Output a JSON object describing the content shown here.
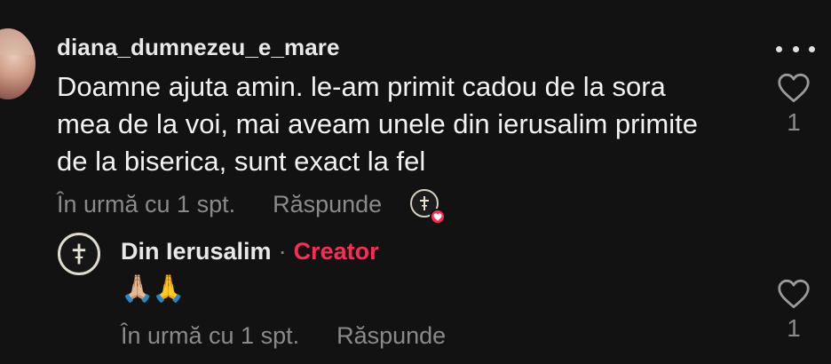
{
  "comment": {
    "username": "diana_dumnezeu_e_mare",
    "text": "Doamne ajuta amin. le-am primit cadou de la sora\nmea de la voi, mai aveam unele din ierusalim primite\nde la biserica, sunt exact la fel",
    "time": "În urmă cu 1 spt.",
    "reply_label": "Răspunde",
    "like_count": "1",
    "liked_by_creator": true
  },
  "reply": {
    "author": "Din Ierusalim",
    "separator": "·",
    "badge": "Creator",
    "text": "🙏🏼🙏",
    "time": "În urmă cu 1 spt.",
    "reply_label": "Răspunde",
    "like_count": "1"
  },
  "colors": {
    "background": "#121212",
    "accent": "#fe2c55",
    "muted": "#8a8a8a"
  },
  "icons": [
    "more-icon",
    "heart-outline-icon",
    "cross-icon",
    "heart-icon"
  ]
}
